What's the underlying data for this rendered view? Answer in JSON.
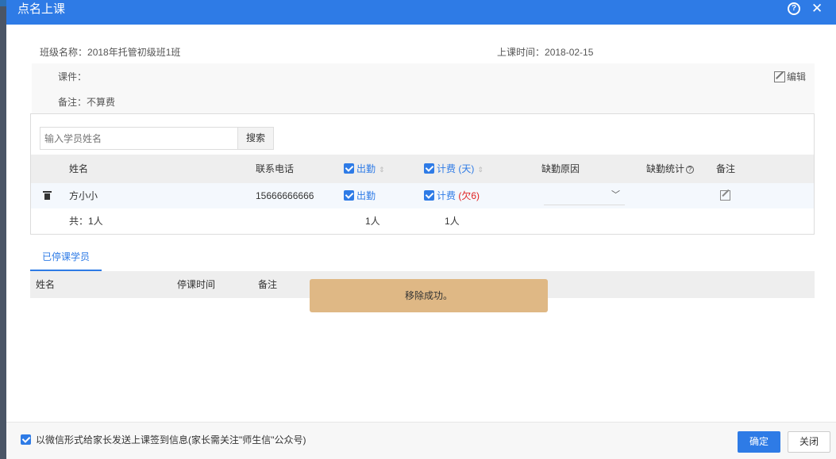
{
  "dialog": {
    "title": "点名上课",
    "help_icon": "question-circle-icon",
    "close_icon": "close-icon"
  },
  "class_info": {
    "class_name_label": "班级名称：",
    "class_name": "2018年托管初级班1班",
    "time_label": "上课时间：",
    "time": "2018-02-15",
    "courseware_label": "课件：",
    "remark_label": "备注：",
    "remark": "不算费",
    "edit_label": "编辑"
  },
  "search": {
    "placeholder": "输入学员姓名",
    "button": "搜索"
  },
  "table": {
    "headers": {
      "name": "姓名",
      "phone": "联系电话",
      "attend": "出勤",
      "charge": "计费 (天)",
      "absent_reason": "缺勤原因",
      "absent_stats": "缺勤统计",
      "note": "备注"
    },
    "rows": [
      {
        "name": "方小小",
        "phone": "15666666666",
        "attend": "出勤",
        "charge": "计费",
        "owed": "(欠6)"
      }
    ],
    "footer": {
      "total": "共：1人",
      "attend_count": "1人",
      "charge_count": "1人"
    }
  },
  "stopped": {
    "tab": "已停课学员",
    "headers": {
      "name": "姓名",
      "stop_time": "停课时间",
      "note": "备注"
    }
  },
  "toast": "移除成功。",
  "footer": {
    "notify": "以微信形式给家长发送上课签到信息(家长需关注\"师生信\"公众号)",
    "ok": "确定",
    "close": "关闭"
  },
  "colors": {
    "primary": "#2e7be6",
    "toast": "#dfb885",
    "owed": "#e02020"
  }
}
